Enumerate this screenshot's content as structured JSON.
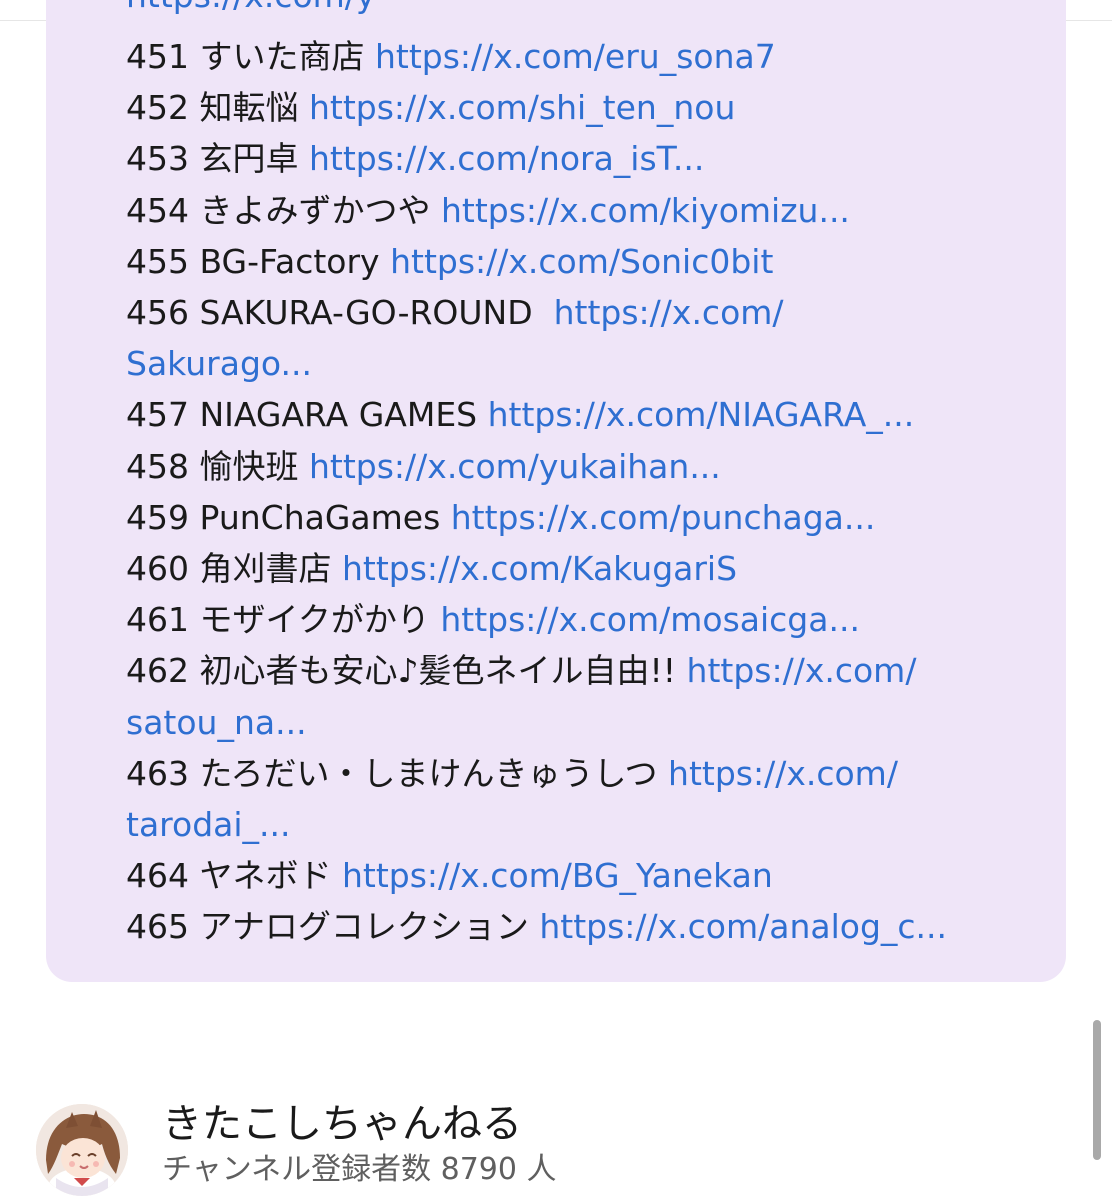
{
  "header": {
    "partial_top_text": "https://x.com/y"
  },
  "entries": [
    {
      "num": "451",
      "name": "すいた商店",
      "link": "https://x.com/eru_sona7"
    },
    {
      "num": "452",
      "name": "知転悩",
      "link": "https://x.com/shi_ten_nou"
    },
    {
      "num": "453",
      "name": "玄円卓",
      "link": "https://x.com/nora_isT..."
    },
    {
      "num": "454",
      "name": "きよみずかつや",
      "link": "https://x.com/kiyomizu..."
    },
    {
      "num": "455",
      "name": "BG-Factory",
      "link": "https://x.com/Sonic0bit"
    },
    {
      "num": "456",
      "name": "SAKURA-GO-ROUND",
      "link_a": "https://x.com/",
      "link_b": "Sakurago..."
    },
    {
      "num": "457",
      "name": "NIAGARA GAMES",
      "link": "https://x.com/NIAGARA_..."
    },
    {
      "num": "458",
      "name": "愉快班",
      "link": "https://x.com/yukaihan..."
    },
    {
      "num": "459",
      "name": "PunChaGames",
      "link": "https://x.com/punchaga..."
    },
    {
      "num": "460",
      "name": "角刈書店",
      "link": "https://x.com/KakugariS"
    },
    {
      "num": "461",
      "name": "モザイクがかり",
      "link": "https://x.com/mosaicga..."
    },
    {
      "num": "462",
      "name": "初心者も安心♪髪色ネイル自由!!",
      "link_a": "https://x.com/",
      "link_b": "satou_na..."
    },
    {
      "num": "463",
      "name": "たろだい・しまけんきゅうしつ",
      "link_a": "https://x.com/",
      "link_b": "tarodai_..."
    },
    {
      "num": "464",
      "name": "ヤネボド",
      "link": "https://x.com/BG_Yanekan"
    },
    {
      "num": "465",
      "name": "アナログコレクション",
      "link": "https://x.com/analog_c..."
    }
  ],
  "channel": {
    "name": "きたこしちゃんねる",
    "subscribers": "チャンネル登録者数 8790 人",
    "avatar_icon": "avatar-girl-icon"
  },
  "colors": {
    "card_bg": "#efe5f8",
    "link": "#2f6fd1",
    "text": "#1a1a1a",
    "subtext": "#5f5f5f"
  }
}
